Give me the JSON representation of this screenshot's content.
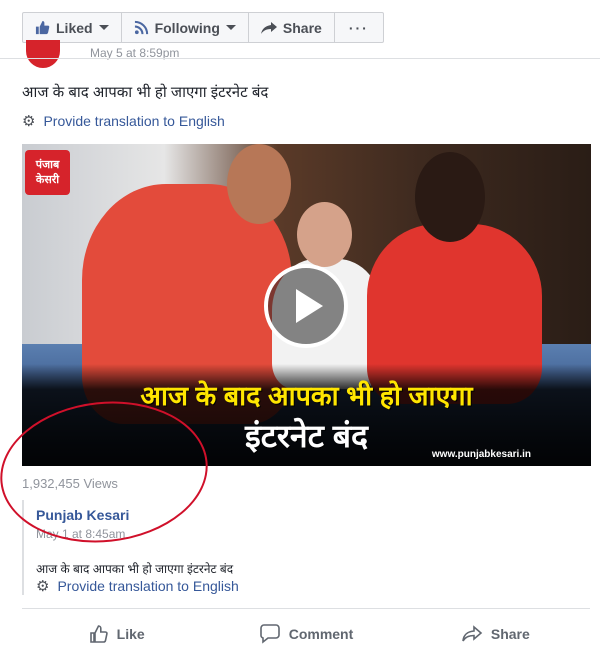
{
  "page_actions": {
    "liked_label": "Liked",
    "following_label": "Following",
    "share_label": "Share",
    "more_label": "···"
  },
  "post": {
    "timestamp_partial": "May 5 at 8:59pm",
    "text": "आज के बाद आपका भी हो जाएगा इंटरनेट बंद",
    "translate_label": "Provide translation to English"
  },
  "video": {
    "logo_line1": "पंजाब",
    "logo_line2": "केसरी",
    "caption_line1": "आज के बाद आपका भी हो जाएगा",
    "caption_line2": "इंटरनेट बंद",
    "watermark": "www.punjabkesari.in",
    "views": "1,932,455 Views"
  },
  "shared": {
    "page_name": "Punjab Kesari",
    "timestamp": "May 1 at 8:45am",
    "text": "आज के बाद आपका भी हो जाएगा इंटरनेट बंद",
    "translate_label": "Provide translation to English"
  },
  "reactions": {
    "like": "Like",
    "comment": "Comment",
    "share": "Share"
  },
  "colors": {
    "link": "#365899",
    "annotation": "#d0102a",
    "caption_yellow": "#ffe600"
  }
}
